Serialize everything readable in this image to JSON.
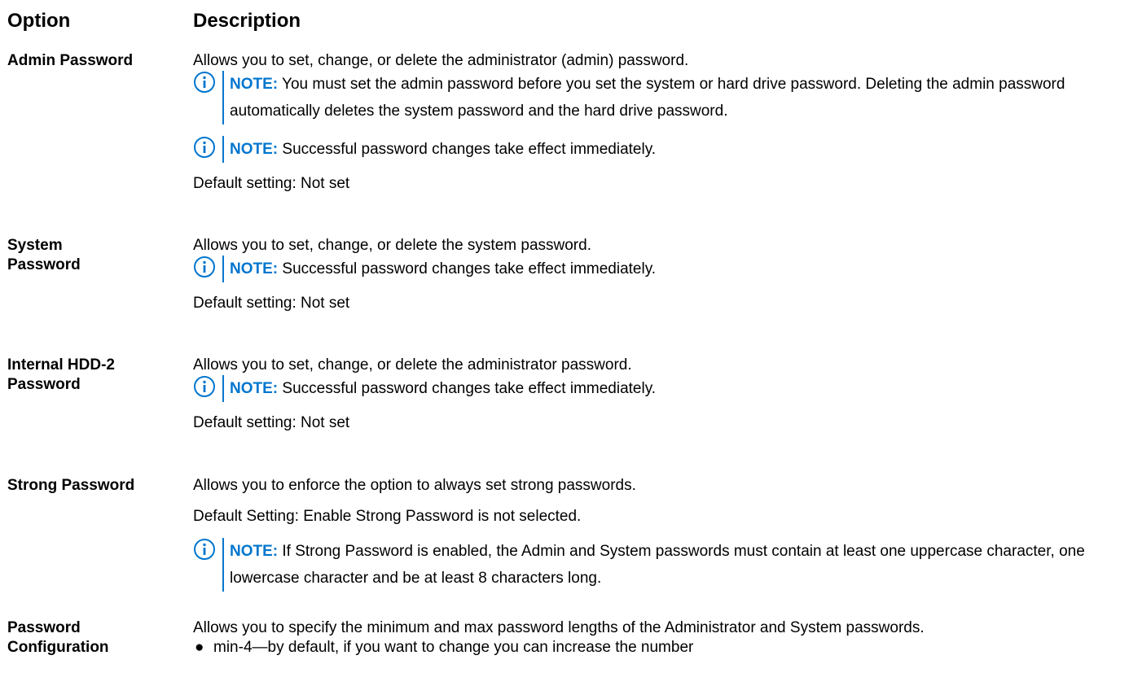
{
  "header": {
    "option": "Option",
    "description": "Description"
  },
  "accent_color": "#0076ce",
  "note_icon": "info-circle-icon",
  "note_label": "NOTE:",
  "rows": [
    {
      "option": "Admin Password",
      "text": "Allows you to set, change, or delete the administrator (admin) password.",
      "notes": [
        "You must set the admin password before you set the system or hard drive password. Deleting the admin password automatically deletes the system password and the hard drive password.",
        "Successful password changes take effect immediately."
      ],
      "default": "Default setting: Not set"
    },
    {
      "option": "System Password",
      "text": "Allows you to set, change, or delete the system password.",
      "notes": [
        "Successful password changes take effect immediately."
      ],
      "default": "Default setting: Not set"
    },
    {
      "option": "Internal HDD-2 Password",
      "text": "Allows you to set, change, or delete the administrator password.",
      "notes": [
        "Successful password changes take effect immediately."
      ],
      "default": "Default setting: Not set"
    },
    {
      "option": "Strong Password",
      "text": "Allows you to enforce the option to always set strong passwords.",
      "default": "Default Setting: Enable Strong Password is not selected.",
      "notes": [
        "If Strong Password is enabled, the Admin and System passwords must contain at least one uppercase character, one lowercase character and be at least 8 characters long."
      ]
    },
    {
      "option": "Password Configuration",
      "text": "Allows you to specify the minimum and max password lengths of the Administrator and System passwords.",
      "bullets": [
        "min-4—by default, if you want to change you can increase the number"
      ]
    }
  ]
}
